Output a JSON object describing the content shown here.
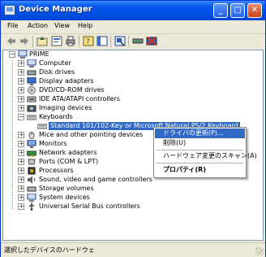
{
  "window": {
    "title": "Device Manager"
  },
  "menubar": {
    "items": [
      "File",
      "Action",
      "View",
      "Help"
    ]
  },
  "toolbar": {
    "buttons": [
      "back-icon",
      "forward-icon",
      "up-icon",
      "properties-icon",
      "print-icon",
      "help-icon",
      "show-hide-tree-icon",
      "scan-hardware-icon",
      "update-driver-icon",
      "uninstall-icon"
    ]
  },
  "tree": {
    "root": "PRIME",
    "categories": [
      "Computer",
      "Disk drives",
      "Display adapters",
      "DVD/CD-ROM drives",
      "IDE ATA/ATAPI controllers",
      "Imaging devices",
      "Keyboards",
      "Mice and other pointing devices",
      "Monitors",
      "Network adapters",
      "Ports (COM & LPT)",
      "Processors",
      "Sound, video and game controllers",
      "Storage volumes",
      "System devices",
      "Universal Serial Bus controllers"
    ],
    "keyboard_child": "Standard 101/102-Key or Microsoft Natural PS/2 Keyboard"
  },
  "context_menu": {
    "update_driver": "ドライバの更新(P)...",
    "uninstall": "削除(U)",
    "scan": "ハードウェア変更のスキャン(A)",
    "properties": "プロパティ(R)"
  },
  "status": {
    "text": "選択したデバイスのハードウェ"
  },
  "colors": {
    "title_bar": "#0054E3",
    "selection": "#316AC5",
    "close": "#C9421B"
  }
}
